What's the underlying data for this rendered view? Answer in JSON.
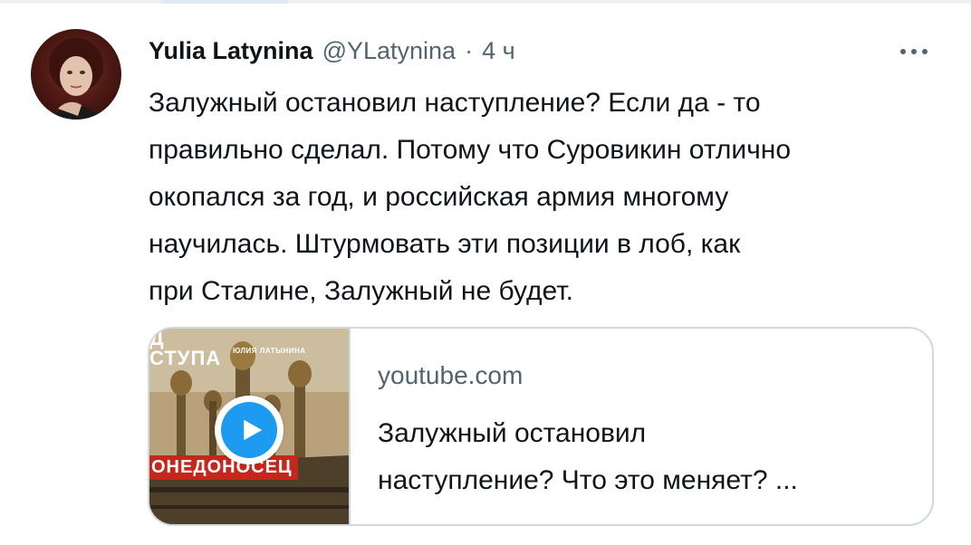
{
  "author": {
    "display_name": "Yulia Latynina",
    "handle": "@YLatynina",
    "separator": "·",
    "time": "4 ч"
  },
  "tweet": {
    "lines": [
      "Залужный остановил наступление? Если да -  то",
      "правильно сделал. Потому что Суровикин отлично",
      "окопался за год, и российская армия многому",
      "научилась. Штурмовать эти позиции в лоб, как",
      "при Сталине, Залужный не будет."
    ]
  },
  "link_card": {
    "domain": "youtube.com",
    "title_lines": [
      "Залужный остановил",
      "наступление? Что это меняет? ..."
    ],
    "thumbnail": {
      "top_text": "Д\nСТУПА",
      "author_text": "ЮЛИЯ ЛАТЫНИНА",
      "red_banner": "ОНЕДОНОСЕЦ"
    }
  },
  "icons": {
    "more": "more-horizontal-icon",
    "play": "play-icon"
  },
  "colors": {
    "text": "#0f1419",
    "secondary": "#536471",
    "border": "#cfd9de",
    "accent": "#1d9bf0",
    "thumb_banner": "#c5271d"
  }
}
